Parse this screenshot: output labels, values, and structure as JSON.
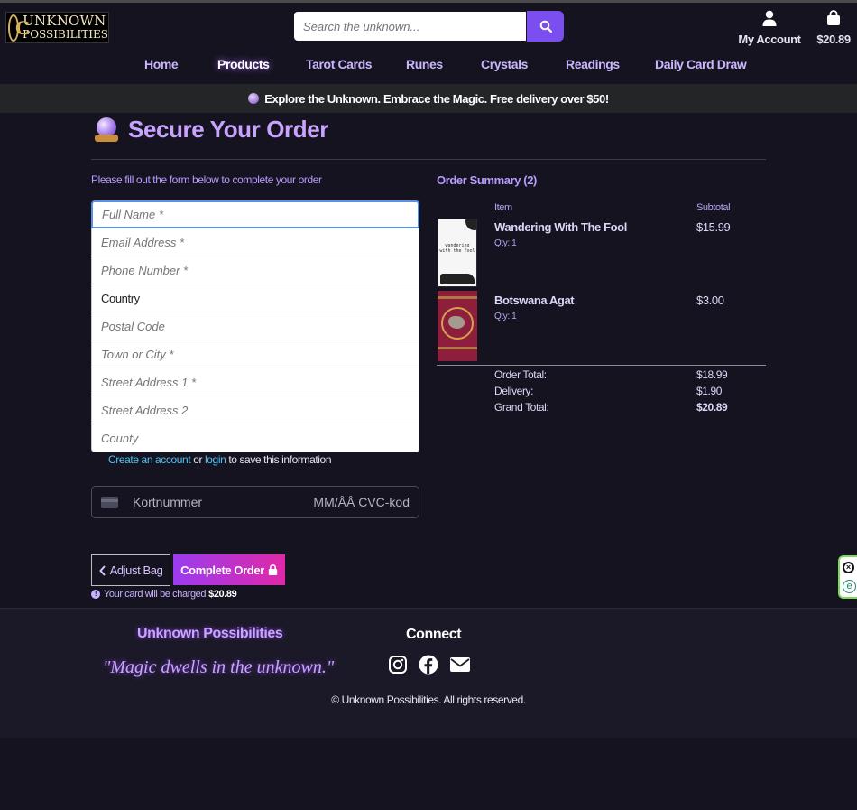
{
  "header": {
    "logo": {
      "line1": "UNKNOWN",
      "line2": "POSSIBILITIES"
    },
    "search": {
      "placeholder": "Search the unknown..."
    },
    "account_label": "My Account",
    "bag_total": "$20.89",
    "nav": [
      "Home",
      "Products",
      "Tarot Cards",
      "Runes",
      "Crystals",
      "Readings",
      "Daily Card Draw"
    ],
    "active_nav": "Products"
  },
  "banner": {
    "text": "Explore the Unknown. Embrace the Magic. Free delivery over $50!"
  },
  "checkout": {
    "title": "Secure Your Order",
    "form_hint": "Please fill out the form below to complete your order",
    "fields": {
      "full_name": "Full Name *",
      "email": "Email Address *",
      "phone": "Phone Number *",
      "country": "Country",
      "postal_code": "Postal Code",
      "town": "Town or City *",
      "street1": "Street Address 1 *",
      "street2": "Street Address 2",
      "county": "County"
    },
    "save_info": {
      "create_account": "Create an account",
      "or": "or",
      "login": "login",
      "suffix": "to save this information"
    },
    "card": {
      "number_placeholder": "Kortnummer",
      "expiry_cvc": "MM/ÅÅ CVC-kod"
    },
    "adjust_bag_label": "Adjust Bag",
    "complete_order_label": "Complete Order",
    "charge_text": "Your card will be charged",
    "charge_amount": "$20.89"
  },
  "order_summary": {
    "title": "Order Summary (2)",
    "col_item": "Item",
    "col_subtotal": "Subtotal",
    "items": [
      {
        "name": "Wandering With The Fool",
        "qty": "Qty: 1",
        "price": "$15.99",
        "thumb_text": "wandering with the fool"
      },
      {
        "name": "Botswana Agat",
        "qty": "Qty: 1",
        "price": "$3.00"
      }
    ],
    "order_total_label": "Order Total:",
    "order_total": "$18.99",
    "delivery_label": "Delivery:",
    "delivery": "$1.90",
    "grand_total_label": "Grand Total:",
    "grand_total": "$20.89"
  },
  "footer": {
    "brand": "Unknown Possibilities",
    "tagline": "\"Magic dwells in the unknown.\"",
    "connect": "Connect",
    "copyright": "© Unknown Possibilities. All rights reserved."
  },
  "colors": {
    "background": "#15131f",
    "accent_purple": "#7b4ef0",
    "heading_purple": "#c9a4ff",
    "complete_gradient_start": "#9b3cf0",
    "complete_gradient_end": "#e028a8",
    "link_blue": "#4fc3f7"
  },
  "icons": [
    "search-icon",
    "user-icon",
    "shopping-bag-icon",
    "crystal-ball-icon",
    "credit-card-icon",
    "chevron-left-icon",
    "lock-icon",
    "info-icon",
    "instagram-icon",
    "facebook-icon",
    "envelope-icon",
    "close-icon"
  ]
}
